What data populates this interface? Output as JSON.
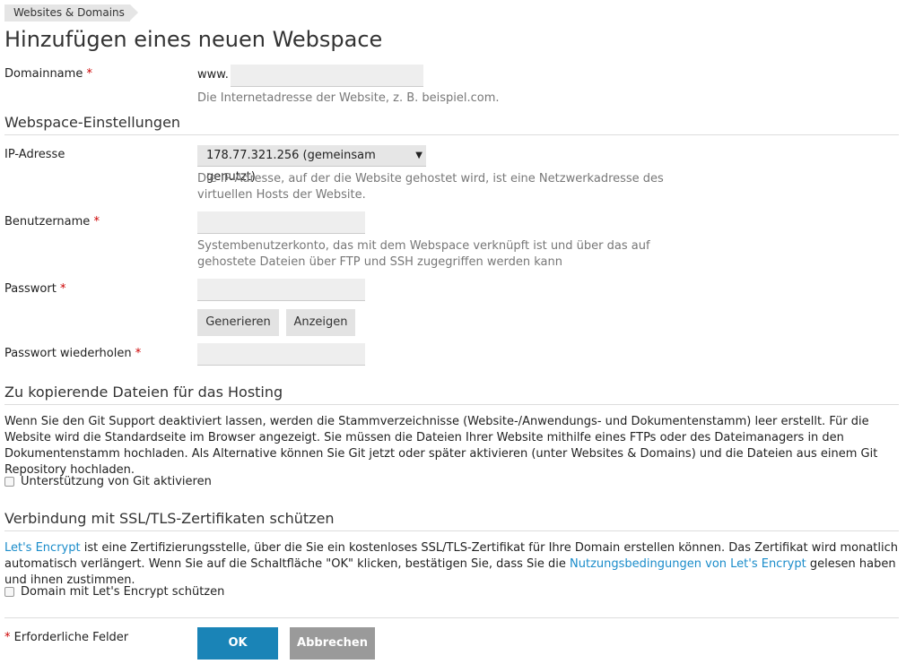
{
  "breadcrumb": "Websites & Domains",
  "title": "Hinzufügen eines neuen Webspace",
  "required_mark": "*",
  "domain": {
    "label": "Domainname",
    "prefix": "www.",
    "value": "",
    "hint": "Die Internetadresse der Website, z. B. beispiel.com."
  },
  "sections": {
    "webspace": "Webspace-Einstellungen",
    "files": "Zu kopierende Dateien für das Hosting",
    "ssl": "Verbindung mit SSL/TLS-Zertifikaten schützen"
  },
  "ip": {
    "label": "IP-Adresse",
    "selected": "178.77.321.256 (gemeinsam genutzt)",
    "hint_line1": "Die IP-Adresse, auf der die Website gehostet wird, ist eine Netzwerkadresse des",
    "hint_line2": "virtuellen Hosts der Website."
  },
  "username": {
    "label": "Benutzername",
    "value": "",
    "hint_line1": "Systembenutzerkonto, das mit dem Webspace verknüpft ist und über das auf",
    "hint_line2": "gehostete Dateien über FTP und SSH zugegriffen werden kann"
  },
  "password": {
    "label": "Passwort",
    "value": "",
    "generate_label": "Generieren",
    "show_label": "Anzeigen"
  },
  "password_repeat": {
    "label": "Passwort wiederholen",
    "value": ""
  },
  "git": {
    "description": "Wenn Sie den Git Support deaktiviert lassen, werden die Stammverzeichnisse (Website-/Anwendungs- und Dokumentenstamm) leer erstellt. Für die Website wird die Standardseite im Browser angezeigt. Sie müssen die Dateien Ihrer Website mithilfe eines FTPs oder des Dateimanagers in den Dokumentenstamm hochladen. Als Alternative können Sie Git jetzt oder später aktivieren (unter Websites & Domains) und die Dateien aus einem Git Repository hochladen.",
    "checkbox_label": "Unterstützung von Git aktivieren",
    "checked": false
  },
  "ssl": {
    "link1": "Let's Encrypt",
    "text1": " ist eine Zertifizierungsstelle, über die Sie ein kostenloses SSL/TLS-Zertifikat für Ihre Domain erstellen können. Das Zertifikat wird monatlich automatisch verlängert. Wenn Sie auf die Schaltfläche \"OK\" klicken, bestätigen Sie, dass Sie die ",
    "link2": "Nutzungsbedingungen von Let's Encrypt",
    "text2": " gelesen haben und ihnen zustimmen.",
    "checkbox_label": "Domain mit Let's Encrypt schützen",
    "checked": false
  },
  "footer": {
    "required_note": "Erforderliche Felder",
    "ok_label": "OK",
    "cancel_label": "Abbrechen"
  },
  "colors": {
    "accent": "#1a84b7",
    "link": "#1a8cca",
    "required": "#cc0000",
    "cancel": "#9a9a9a"
  }
}
